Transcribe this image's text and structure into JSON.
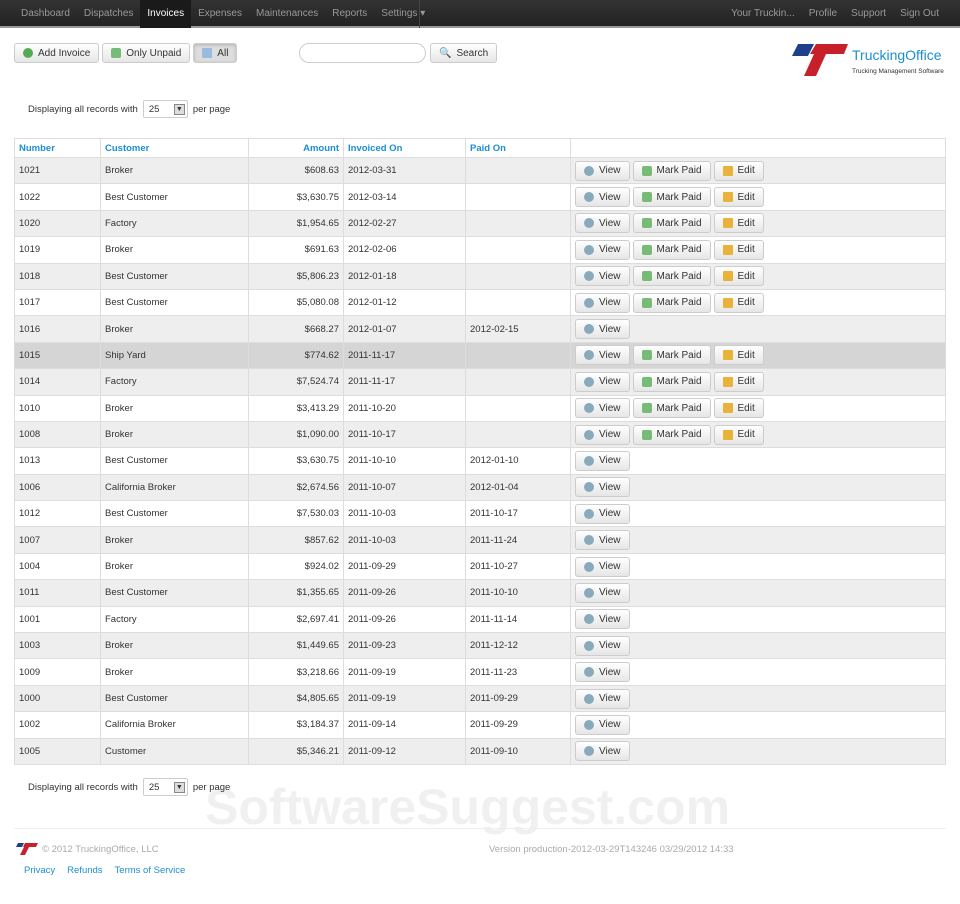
{
  "nav": {
    "items": [
      "Dashboard",
      "Dispatches",
      "Invoices",
      "Expenses",
      "Maintenances",
      "Reports",
      "Settings ▾"
    ],
    "active": 2,
    "right": [
      "Your Truckin...",
      "Profile",
      "Support",
      "Sign Out"
    ]
  },
  "toolbar": {
    "add": "Add Invoice",
    "unpaid": "Only Unpaid",
    "all": "All",
    "search": "Search",
    "search_value": ""
  },
  "logo": {
    "title": "TruckingOffice",
    "subtitle": "Trucking Management Software"
  },
  "pager": {
    "pre": "Displaying all records with",
    "value": "25",
    "post": "per page"
  },
  "table": {
    "headers": [
      "Number",
      "Customer",
      "Amount",
      "Invoiced On",
      "Paid On"
    ],
    "actions": {
      "view": "View",
      "mark_paid": "Mark Paid",
      "edit": "Edit"
    },
    "rows": [
      [
        "1021",
        "Broker",
        "$608.63",
        "2012-03-31",
        ""
      ],
      [
        "1022",
        "Best Customer",
        "$3,630.75",
        "2012-03-14",
        ""
      ],
      [
        "1020",
        "Factory",
        "$1,954.65",
        "2012-02-27",
        ""
      ],
      [
        "1019",
        "Broker",
        "$691.63",
        "2012-02-06",
        ""
      ],
      [
        "1018",
        "Best Customer",
        "$5,806.23",
        "2012-01-18",
        ""
      ],
      [
        "1017",
        "Best Customer",
        "$5,080.08",
        "2012-01-12",
        ""
      ],
      [
        "1016",
        "Broker",
        "$668.27",
        "2012-01-07",
        "2012-02-15"
      ],
      [
        "1015",
        "Ship Yard",
        "$774.62",
        "2011-11-17",
        ""
      ],
      [
        "1014",
        "Factory",
        "$7,524.74",
        "2011-11-17",
        ""
      ],
      [
        "1010",
        "Broker",
        "$3,413.29",
        "2011-10-20",
        ""
      ],
      [
        "1008",
        "Broker",
        "$1,090.00",
        "2011-10-17",
        ""
      ],
      [
        "1013",
        "Best Customer",
        "$3,630.75",
        "2011-10-10",
        "2012-01-10"
      ],
      [
        "1006",
        "California Broker",
        "$2,674.56",
        "2011-10-07",
        "2012-01-04"
      ],
      [
        "1012",
        "Best Customer",
        "$7,530.03",
        "2011-10-03",
        "2011-10-17"
      ],
      [
        "1007",
        "Broker",
        "$857.62",
        "2011-10-03",
        "2011-11-24"
      ],
      [
        "1004",
        "Broker",
        "$924.02",
        "2011-09-29",
        "2011-10-27"
      ],
      [
        "1011",
        "Best Customer",
        "$1,355.65",
        "2011-09-26",
        "2011-10-10"
      ],
      [
        "1001",
        "Factory",
        "$2,697.41",
        "2011-09-26",
        "2011-11-14"
      ],
      [
        "1003",
        "Broker",
        "$1,449.65",
        "2011-09-23",
        "2011-12-12"
      ],
      [
        "1009",
        "Broker",
        "$3,218.66",
        "2011-09-19",
        "2011-11-23"
      ],
      [
        "1000",
        "Best Customer",
        "$4,805.65",
        "2011-09-19",
        "2011-09-29"
      ],
      [
        "1002",
        "California Broker",
        "$3,184.37",
        "2011-09-14",
        "2011-09-29"
      ],
      [
        "1005",
        "Customer",
        "$5,346.21",
        "2011-09-12",
        "2011-09-10"
      ]
    ],
    "highlight": "1015"
  },
  "footer": {
    "copyright": "© 2012 TruckingOffice, LLC",
    "version": "Version production-2012-03-29T143246 03/29/2012 14:33",
    "links": [
      "Privacy",
      "Refunds",
      "Terms of Service"
    ],
    "watermark": "SoftwareSuggest.com"
  },
  "colors": {
    "link": "#1b8fd6",
    "logo_red": "#c8202a",
    "logo_blue": "#1e3f8a"
  }
}
